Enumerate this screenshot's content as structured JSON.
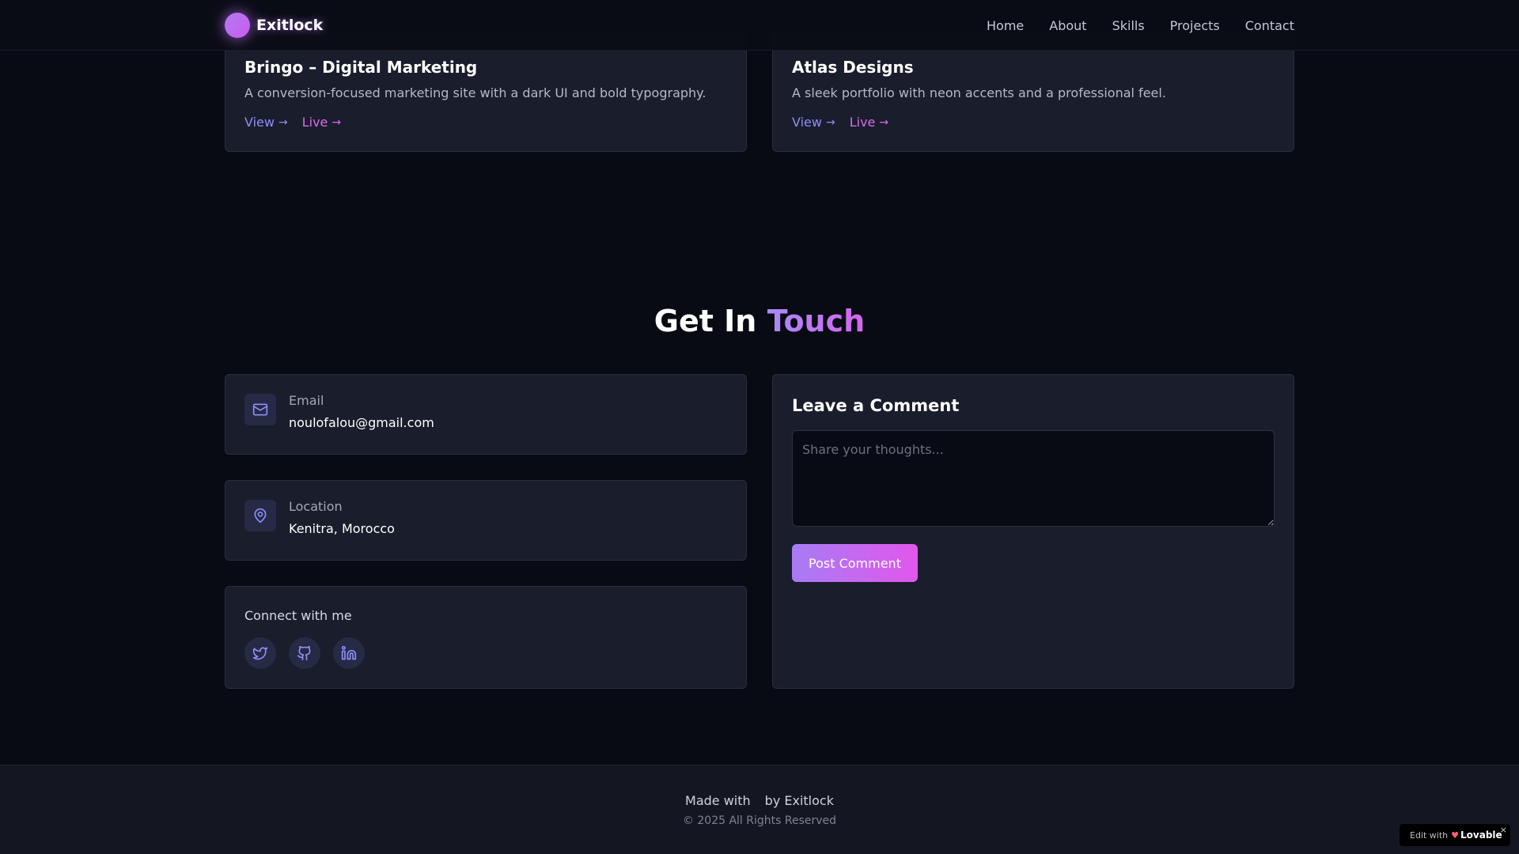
{
  "nav": {
    "brand": "Exitlock",
    "links": [
      "Home",
      "About",
      "Skills",
      "Projects",
      "Contact"
    ]
  },
  "projects": [
    {
      "title": "Bringo – Digital Marketing",
      "description": "A conversion-focused marketing site with a dark UI and bold typography.",
      "view_label": "View",
      "live_label": "Live"
    },
    {
      "title": "Atlas Designs",
      "description": "A sleek portfolio with neon accents and a professional feel.",
      "view_label": "View",
      "live_label": "Live"
    }
  ],
  "contact": {
    "title_prefix": "Get In",
    "title_accent": "Touch",
    "email": {
      "label": "Email",
      "value": "noulofalou@gmail.com",
      "icon": "mail-icon"
    },
    "location": {
      "label": "Location",
      "value": "Kenitra, Morocco",
      "icon": "map-pin-icon"
    },
    "social": {
      "label": "Connect with me",
      "icons": [
        "twitter-icon",
        "github-icon",
        "linkedin-icon"
      ]
    }
  },
  "comment": {
    "title": "Leave a Comment",
    "placeholder": "Share your thoughts...",
    "button_label": "Post Comment"
  },
  "footer": {
    "made_with": "Made with",
    "by": "by Exitlock",
    "copyright": "© 2025 All Rights Reserved"
  },
  "badge": {
    "prefix": "Edit with",
    "brand": "Lovable",
    "close": "×"
  },
  "colors": {
    "background": "#080b14",
    "card": "#1a1d2b",
    "accent_purple": "#a98af5",
    "accent_pink": "#d566ee",
    "link_view": "#8f8ef7",
    "link_live": "#d76cf0"
  }
}
